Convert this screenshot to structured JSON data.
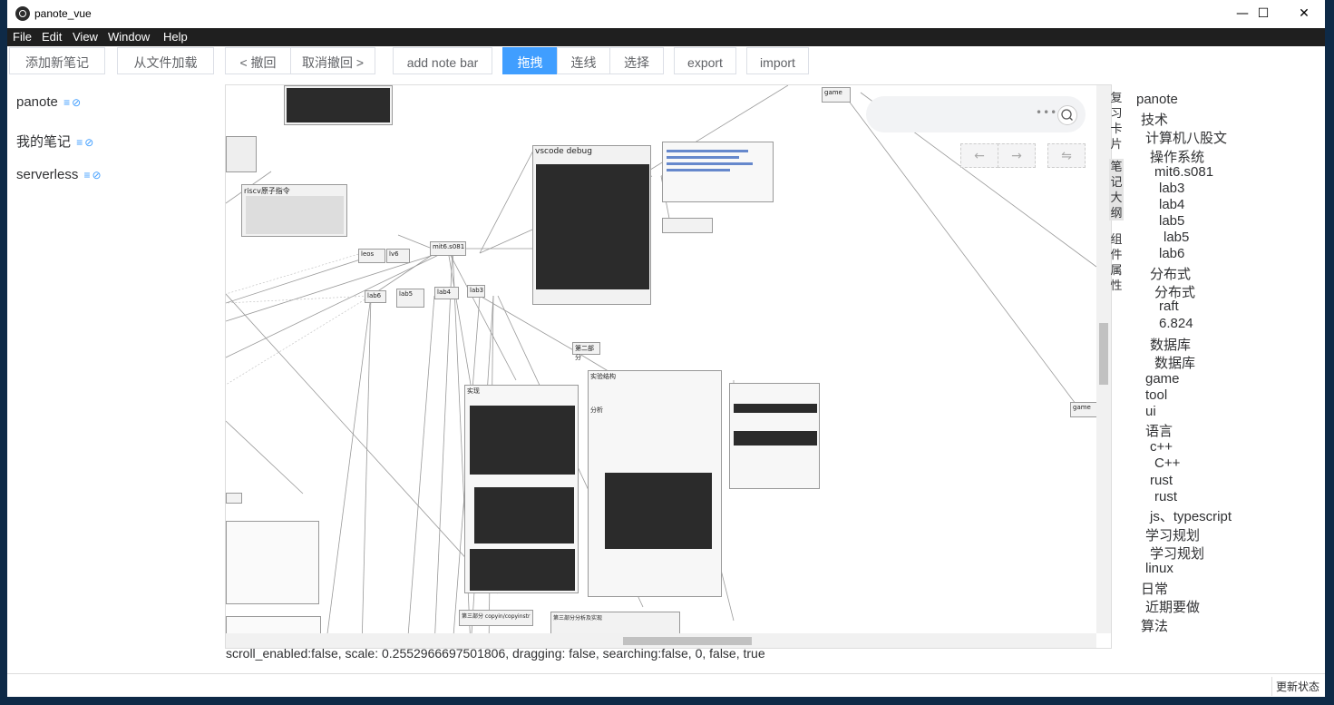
{
  "window": {
    "title": "panote_vue",
    "minimize_glyph": "—",
    "maximize_glyph": "☐",
    "close_glyph": "✕"
  },
  "menu": [
    "File",
    "Edit",
    "View",
    "Window",
    "Help"
  ],
  "toolbar": {
    "add_note": "添加新笔记",
    "load_file": "从文件加载",
    "undo": "< 撤回",
    "redo": "取消撤回 >",
    "add_note_bar": "add note bar",
    "drag": "拖拽",
    "connect": "连线",
    "select": "选择",
    "export": "export",
    "import": "import",
    "active_mode_color": "#409eff"
  },
  "notes": [
    {
      "label": "panote",
      "icon": "list-icon",
      "icon_glyph": "≡",
      "link_glyph": "⊘"
    },
    {
      "label": "我的笔记",
      "icon": "list-icon",
      "icon_glyph": "≡",
      "link_glyph": "⊘"
    },
    {
      "label": "serverless",
      "icon": "list-icon",
      "icon_glyph": "≡",
      "link_glyph": "⊘"
    }
  ],
  "canvas": {
    "search_dots": "•••",
    "nav_back": "←",
    "nav_forward": "→",
    "nav_swap": "⇋",
    "nodes": {
      "game_top": "game",
      "game_right": "game",
      "vscode": "vscode debug",
      "riscv": "riscv原子指令",
      "leos": "leos",
      "lv6": "lv6",
      "mit": "mit6.s081",
      "lab6": "lab6",
      "lab5": "lab5",
      "lab4": "lab4",
      "lab3": "lab3",
      "part2": "第二部分",
      "impl": "实现",
      "exp": "实验结构",
      "analysis": "分析",
      "part3": "第三部分 copyin/copyinstr",
      "part3b": "第三部分分析及实现"
    }
  },
  "status_line": "scroll_enabled:false, scale: 0.2552966697501806, dragging: false, searching:false, 0, false, true",
  "side_tabs": [
    "复习卡片",
    "笔记大纲",
    "组件属性"
  ],
  "outline": [
    {
      "label": "panote",
      "level": 0
    },
    {
      "label": "技术",
      "level": 1
    },
    {
      "label": "计算机八股文",
      "level": 2
    },
    {
      "label": "操作系统",
      "level": 3
    },
    {
      "label": "mit6.s081",
      "level": 4
    },
    {
      "label": "lab3",
      "level": 5
    },
    {
      "label": "lab4",
      "level": 5
    },
    {
      "label": "lab5",
      "level": 5
    },
    {
      "label": "lab5",
      "level": 6
    },
    {
      "label": "lab6",
      "level": 5
    },
    {
      "label": "分布式",
      "level": 3
    },
    {
      "label": "分布式",
      "level": 4
    },
    {
      "label": "raft",
      "level": 5
    },
    {
      "label": "6.824",
      "level": 5
    },
    {
      "label": "数据库",
      "level": 3
    },
    {
      "label": "数据库",
      "level": 4
    },
    {
      "label": "game",
      "level": 2
    },
    {
      "label": "tool",
      "level": 2
    },
    {
      "label": "ui",
      "level": 2
    },
    {
      "label": "语言",
      "level": 2
    },
    {
      "label": "c++",
      "level": 3
    },
    {
      "label": "C++",
      "level": 4
    },
    {
      "label": "rust",
      "level": 3
    },
    {
      "label": "rust",
      "level": 4
    },
    {
      "label": "js、typescript",
      "level": 3
    },
    {
      "label": "学习规划",
      "level": 2
    },
    {
      "label": "学习规划",
      "level": 3
    },
    {
      "label": "linux",
      "level": 2
    },
    {
      "label": "日常",
      "level": 1
    },
    {
      "label": "近期要做",
      "level": 2
    },
    {
      "label": "算法",
      "level": 1
    }
  ],
  "statusbar": {
    "update_button": "更新状态"
  }
}
